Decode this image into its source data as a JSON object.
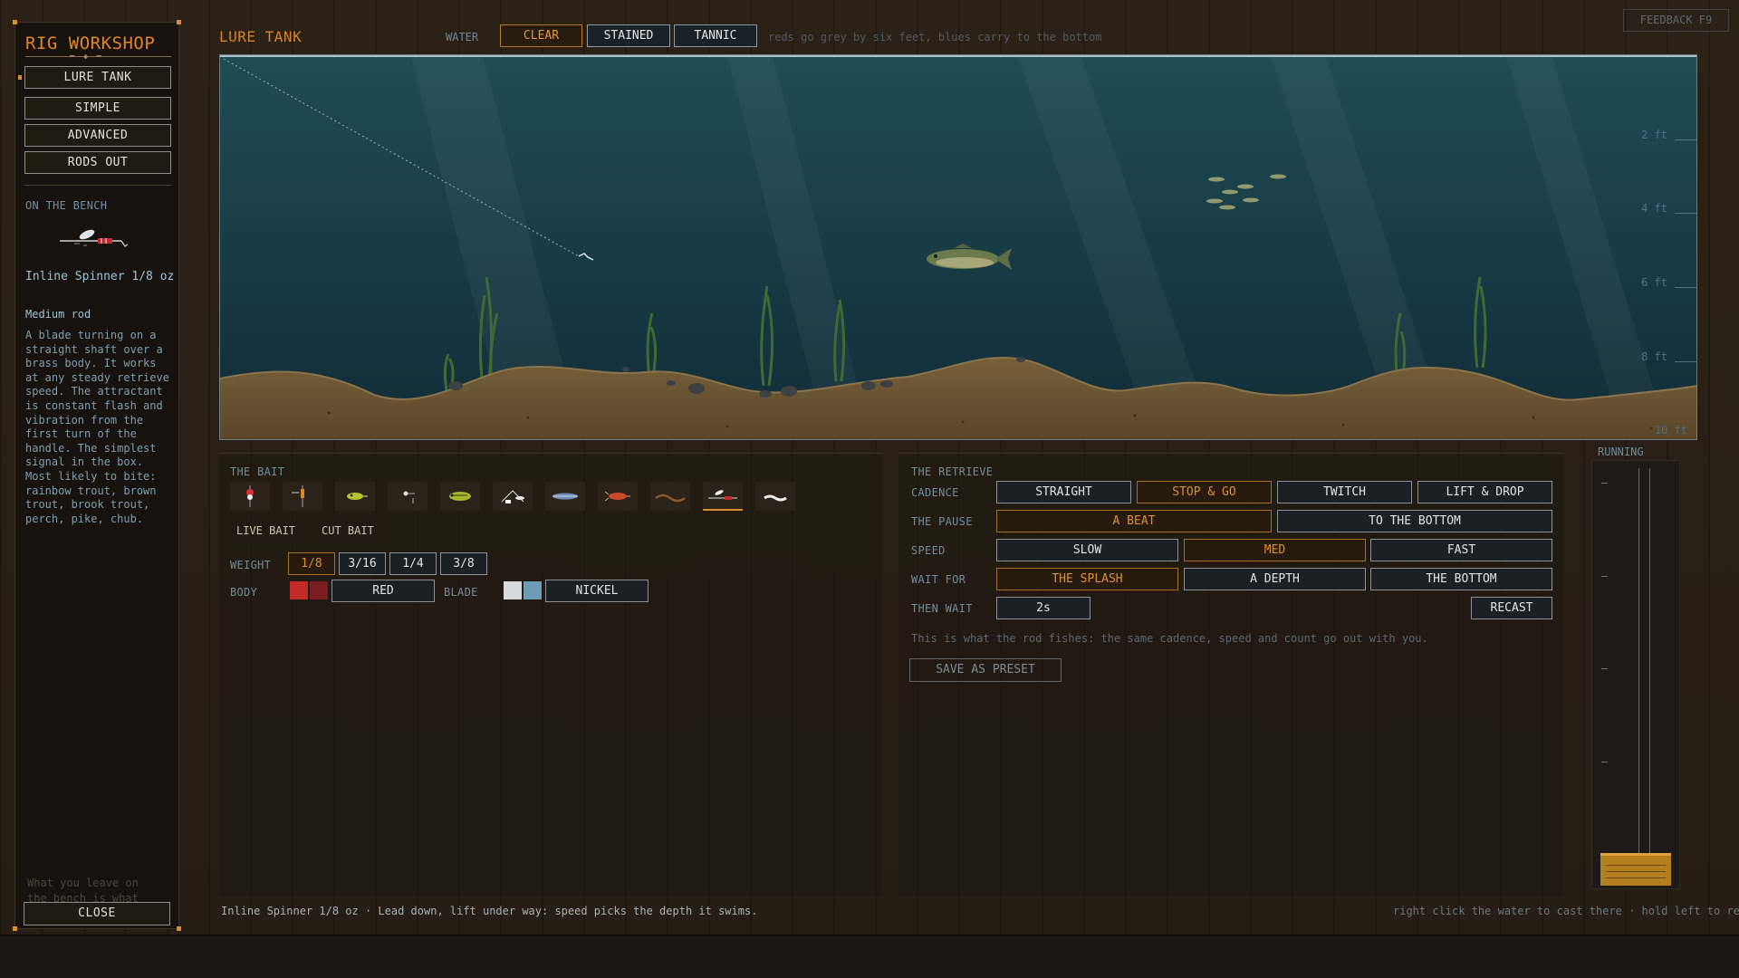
{
  "sidebar": {
    "title": "RIG WORKSHOP",
    "nav": [
      "LURE TANK",
      "SIMPLE",
      "ADVANCED",
      "RODS OUT"
    ],
    "bench_label": "ON THE BENCH",
    "lure_name": "Inline Spinner 1/8 oz",
    "rod": "Medium rod",
    "description": "A blade turning on a straight shaft over a brass body. It works at any steady retrieve speed. The attractant is constant flash and vibration from the first turn of the handle. The simplest signal in the box. Most likely to bite: rainbow trout, brown trout, brook trout, perch, pike, chub.",
    "footnote": "What you leave on the bench is what",
    "close_label": "CLOSE"
  },
  "header": {
    "title": "LURE TANK",
    "water_label": "WATER",
    "water_options": [
      "CLEAR",
      "STAINED",
      "TANNIC"
    ],
    "water_selected": "CLEAR",
    "water_hint": "reds go grey by six feet, blues carry to the bottom",
    "feedback": "FEEDBACK  F9"
  },
  "tank": {
    "depth_labels": [
      "2 ft",
      "4 ft",
      "6 ft",
      "8 ft",
      "10 ft"
    ]
  },
  "bait": {
    "section_label": "THE BAIT",
    "icons": [
      "bobber-rig-icon",
      "float-rig-icon",
      "spoon-icon",
      "jig-icon",
      "crankbait-icon",
      "spinnerbait-icon",
      "minnow-plug-icon",
      "crawfish-icon",
      "worm-icon",
      "inline-spinner-icon",
      "grub-icon"
    ],
    "selected_index": 9,
    "tabs": [
      "LIVE BAIT",
      "CUT BAIT"
    ],
    "weight_label": "WEIGHT",
    "weights": [
      "1/8",
      "3/16",
      "1/4",
      "3/8"
    ],
    "weight_selected": "1/8",
    "body_label": "BODY",
    "body_colors": [
      "#c42a2a",
      "#7a1c22"
    ],
    "body_value": "RED",
    "blade_label": "BLADE",
    "blade_colors": [
      "#d7d9dc",
      "#6d9bb5"
    ],
    "blade_value": "NICKEL"
  },
  "retrieve": {
    "section_label": "THE RETRIEVE",
    "cadence_label": "CADENCE",
    "cadence": [
      "STRAIGHT",
      "STOP & GO",
      "TWITCH",
      "LIFT & DROP"
    ],
    "cadence_selected": "STOP & GO",
    "pause_label": "THE PAUSE",
    "pause": [
      "A BEAT",
      "TO THE BOTTOM"
    ],
    "pause_selected": "A BEAT",
    "speed_label": "SPEED",
    "speed": [
      "SLOW",
      "MED",
      "FAST"
    ],
    "speed_selected": "MED",
    "waitfor_label": "WAIT FOR",
    "waitfor": [
      "THE SPLASH",
      "A DEPTH",
      "THE BOTTOM"
    ],
    "waitfor_selected": "THE SPLASH",
    "thenwait_label": "THEN WAIT",
    "thenwait_value": "2s",
    "recast": "RECAST",
    "note": "This is what the rod fishes: the same cadence, speed and count go out with you.",
    "save_preset": "SAVE AS PRESET"
  },
  "running": {
    "label": "RUNNING"
  },
  "status": {
    "left": "Inline Spinner 1/8 oz · Lead down, lift under way: speed picks the depth it swims.",
    "right": "right click the water to cast there · hold left to re"
  },
  "colors": {
    "accent": "#d8902c",
    "water": "#1d4650",
    "sand": "#6e5532"
  }
}
